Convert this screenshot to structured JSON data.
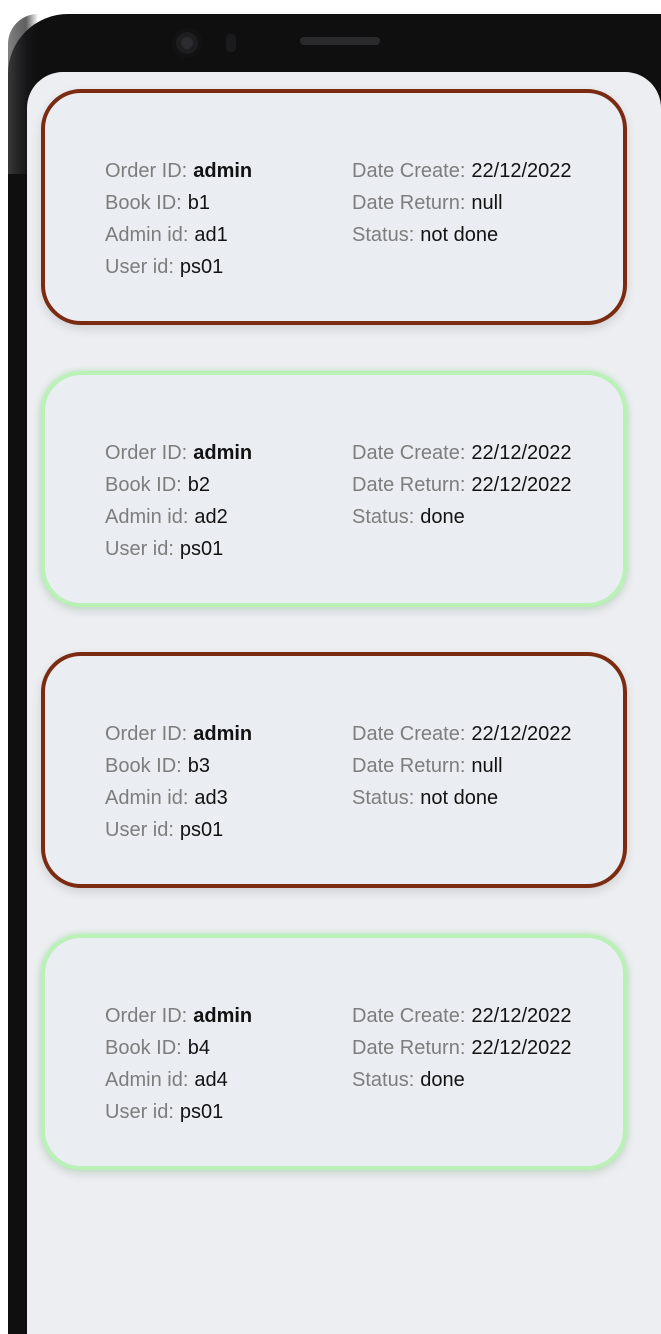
{
  "labels": {
    "order_id": "Order ID:",
    "book_id": "Book ID:",
    "admin_id": "Admin id:",
    "user_id": "User id:",
    "date_create": "Date Create:",
    "date_return": "Date Return:",
    "status": "Status:"
  },
  "status_colors": {
    "not_done": "#7a2b12",
    "done": "#b9f1b6"
  },
  "orders": [
    {
      "order_id": "admin",
      "book_id": "b1",
      "admin_id": "ad1",
      "user_id": "ps01",
      "date_create": "22/12/2022",
      "date_return": "null",
      "status": "not done"
    },
    {
      "order_id": "admin",
      "book_id": "b2",
      "admin_id": "ad2",
      "user_id": "ps01",
      "date_create": "22/12/2022",
      "date_return": "22/12/2022",
      "status": "done"
    },
    {
      "order_id": "admin",
      "book_id": "b3",
      "admin_id": "ad3",
      "user_id": "ps01",
      "date_create": "22/12/2022",
      "date_return": "null",
      "status": "not done"
    },
    {
      "order_id": "admin",
      "book_id": "b4",
      "admin_id": "ad4",
      "user_id": "ps01",
      "date_create": "22/12/2022",
      "date_return": "22/12/2022",
      "status": "done"
    }
  ]
}
